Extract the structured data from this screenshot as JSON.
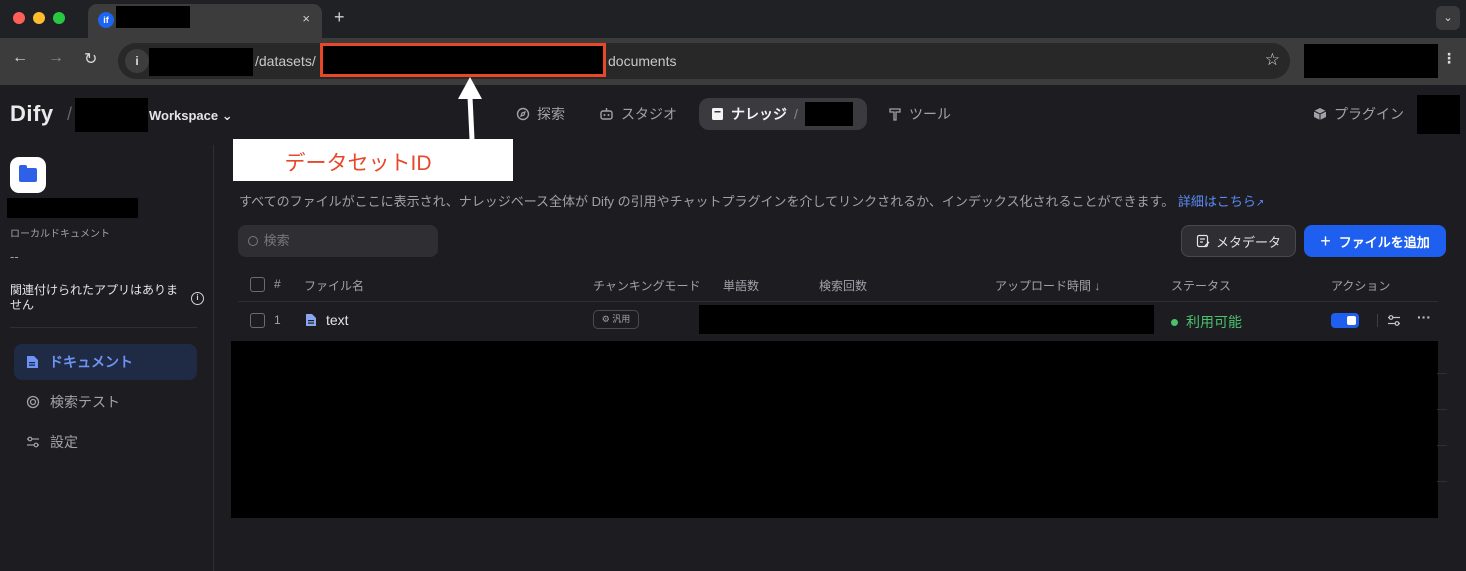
{
  "browser": {
    "traffic_lights": [
      "#ff5f57",
      "#febc2e",
      "#28c840"
    ],
    "tab": {
      "favicon": "if",
      "close": "×"
    },
    "new_tab": "+",
    "tab_menu": "⌄",
    "nav": {
      "back": "←",
      "forward": "→",
      "reload": "↻"
    },
    "url": {
      "info": "i",
      "part1": "/datasets/",
      "part2": "documents"
    },
    "star": "☆",
    "menu": "⋮"
  },
  "app": {
    "logo": "Dify",
    "separator": "/",
    "workspace": "Workspace",
    "workspace_caret": "⌄",
    "nav": {
      "explore": "探索",
      "studio": "スタジオ",
      "knowledge": "ナレッジ",
      "knowledge_sep": "/",
      "tools": "ツール",
      "plugins": "プラグイン"
    }
  },
  "annotation": {
    "label": "データセットID",
    "color": "#e8472a"
  },
  "sidebar": {
    "doc_type": "ローカルドキュメント",
    "dash": "--",
    "no_apps": "関連付けられたアプリはありません",
    "info_icon": "i",
    "menu": [
      "ドキュメント",
      "検索テスト",
      "設定"
    ]
  },
  "main": {
    "description": "すべてのファイルがここに表示され、ナレッジベース全体が Dify の引用やチャットプラグインを介してリンクされるか、インデックス化されることができます。",
    "description_link": "詳細はこちら",
    "search_placeholder": "検索",
    "metadata_button": "メタデータ",
    "add_file_button": "ファイルを追加",
    "accent_color": "#1f5ff0",
    "table": {
      "headers": {
        "num": "#",
        "name": "ファイル名",
        "chunk": "チャンキングモード",
        "words": "単語数",
        "hits": "検索回数",
        "upload": "アップロード時間",
        "sort": "↓",
        "status": "ステータス",
        "action": "アクション"
      },
      "rows": [
        {
          "num": "1",
          "name": "text",
          "chunk": "汎用",
          "status": "利用可能",
          "enabled": true,
          "more": "···"
        }
      ]
    }
  }
}
